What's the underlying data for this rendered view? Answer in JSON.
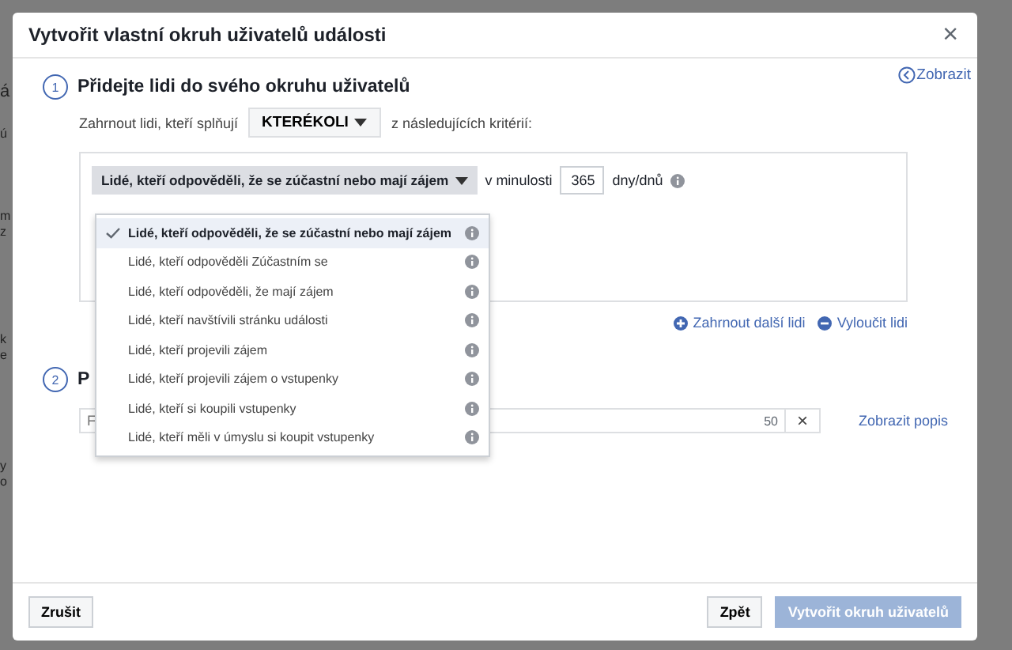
{
  "backdrop_fragments": [
    "á",
    "ú",
    "m",
    "z",
    "k",
    "e",
    "y",
    "o"
  ],
  "dialog": {
    "title": "Vytvořit vlastní okruh uživatelů události",
    "close": "×"
  },
  "step1": {
    "number": "1",
    "title": "Přidejte lidi do svého okruhu uživatelů",
    "show_link": "Zobrazit",
    "criteria_prefix": "Zahrnout lidi, kteří splňují",
    "match": "KTERÉKOLI",
    "criteria_suffix": "z následujících kritérií:",
    "rule": {
      "type": "Lidé, kteří odpověděli, že se zúčastní nebo mají zájem",
      "period_label": "v minulosti",
      "days": "365",
      "days_unit": "dny/dnů"
    },
    "include_link": "Zahrnout další lidi",
    "exclude_link": "Vyloučit lidi"
  },
  "step2": {
    "number": "2",
    "title": "P",
    "name_placeholder": "F",
    "char_count": "50",
    "clear": "×",
    "describe_link": "Zobrazit popis"
  },
  "menu": [
    {
      "label": "Lidé, kteří odpověděli, že se zúčastní nebo mají zájem",
      "selected": true
    },
    {
      "label": "Lidé, kteří odpověděli Zúčastním se",
      "selected": false
    },
    {
      "label": "Lidé, kteří odpověděli, že mají zájem",
      "selected": false
    },
    {
      "label": "Lidé, kteří navštívili stránku události",
      "selected": false
    },
    {
      "label": "Lidé, kteří projevili zájem",
      "selected": false
    },
    {
      "label": "Lidé, kteří projevili zájem o vstupenky",
      "selected": false
    },
    {
      "label": "Lidé, kteří si koupili vstupenky",
      "selected": false
    },
    {
      "label": "Lidé, kteří měli v úmyslu si koupit vstupenky",
      "selected": false
    }
  ],
  "footer": {
    "cancel": "Zrušit",
    "back": "Zpět",
    "create": {
      "label": "Vytvořit okruh uživatelů",
      "disabled": true
    }
  }
}
